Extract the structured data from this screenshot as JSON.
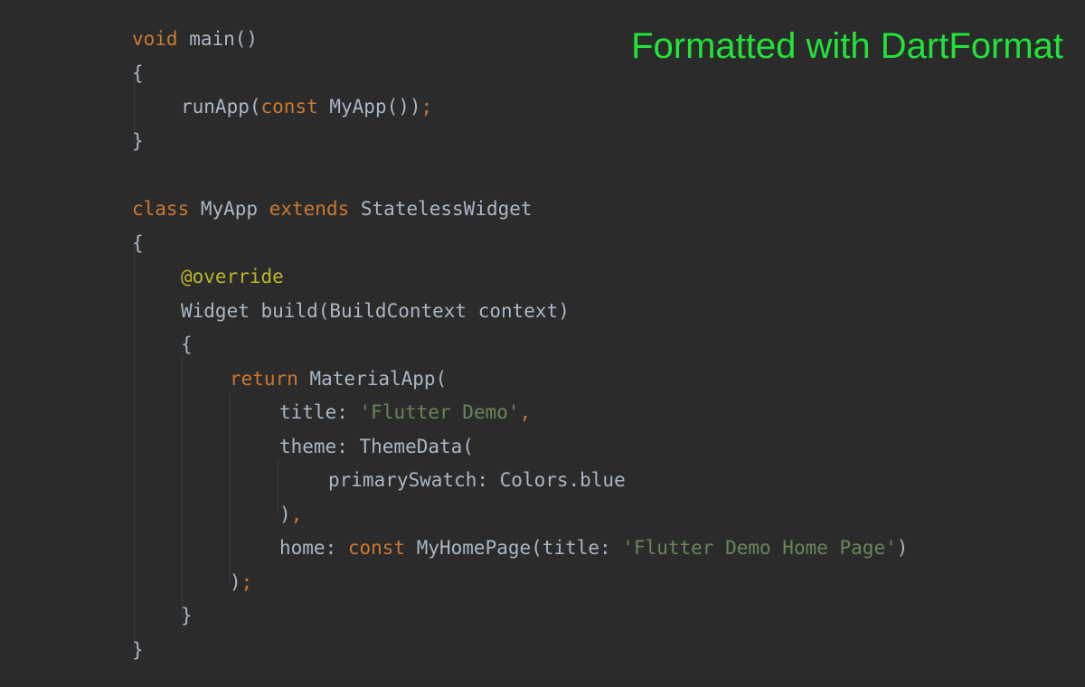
{
  "caption": "Formatted with DartFormat",
  "colors": {
    "background": "#2b2b2b",
    "caption": "#22e33a",
    "keyword": "#cc7832",
    "string": "#6a8759",
    "identifier": "#a9b7c6",
    "annotation": "#bbb529",
    "indent_guide": "#3d3d3d"
  },
  "code": {
    "l1": {
      "kw": "void",
      "rest": " main()"
    },
    "l2": "{",
    "l3": {
      "a": "runApp(",
      "kw": "const",
      "b": " MyApp())",
      "semi": ";"
    },
    "l4": "}",
    "l5": {
      "kw1": "class",
      "mid": " MyApp ",
      "kw2": "extends",
      "rest": " StatelessWidget"
    },
    "l6": "{",
    "l7": "@override",
    "l8": "Widget build(BuildContext context)",
    "l9": "{",
    "l10": {
      "kw": "return",
      "rest": " MaterialApp("
    },
    "l11": {
      "a": "title: ",
      "str": "'Flutter Demo'",
      "comma": ","
    },
    "l12": "theme: ThemeData(",
    "l13": "primarySwatch: Colors.blue",
    "l14": {
      "a": ")",
      "comma": ","
    },
    "l15": {
      "a": "home: ",
      "kw": "const",
      "b": " MyHomePage(title: ",
      "str": "'Flutter Demo Home Page'",
      "c": ")"
    },
    "l16": {
      "a": ")",
      "semi": ";"
    },
    "l17": "}",
    "l18": "}"
  }
}
